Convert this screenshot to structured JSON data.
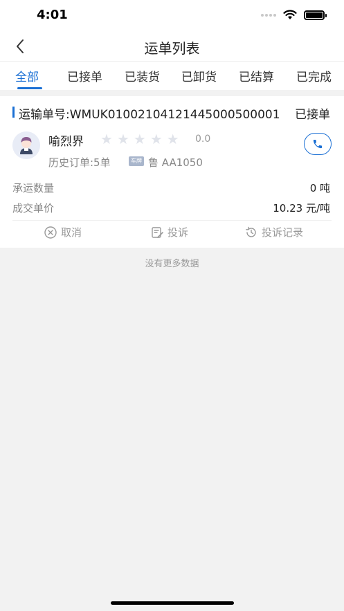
{
  "status_bar": {
    "time": "4:01"
  },
  "nav": {
    "title": "运单列表"
  },
  "tabs": [
    {
      "label": "全部",
      "active": true
    },
    {
      "label": "已接单"
    },
    {
      "label": "已装货"
    },
    {
      "label": "已卸货"
    },
    {
      "label": "已结算"
    },
    {
      "label": "已完成"
    }
  ],
  "order": {
    "waybill_no": "运输单号:WMUK01002104121445000500001",
    "status": "已接单",
    "driver_name": "喻烈界",
    "stars": 5,
    "rating": "0.0",
    "history": "历史订单:5单",
    "plate_tag": "车牌",
    "plate": "鲁 AA1050",
    "quantity_label": "承运数量",
    "quantity_value": "0 吨",
    "price_label": "成交单价",
    "price_value": "10.23 元/吨",
    "actions": {
      "cancel": "取消",
      "complain": "投诉",
      "complaint_records": "投诉记录"
    }
  },
  "footer": {
    "no_more": "没有更多数据"
  },
  "colors": {
    "accent": "#1a6fd4",
    "background": "#f2f2f2"
  },
  "icons": [
    "back-arrow-icon",
    "star-icon",
    "phone-icon",
    "close-circle-icon",
    "complaint-icon",
    "history-icon",
    "wifi-icon",
    "battery-icon"
  ]
}
